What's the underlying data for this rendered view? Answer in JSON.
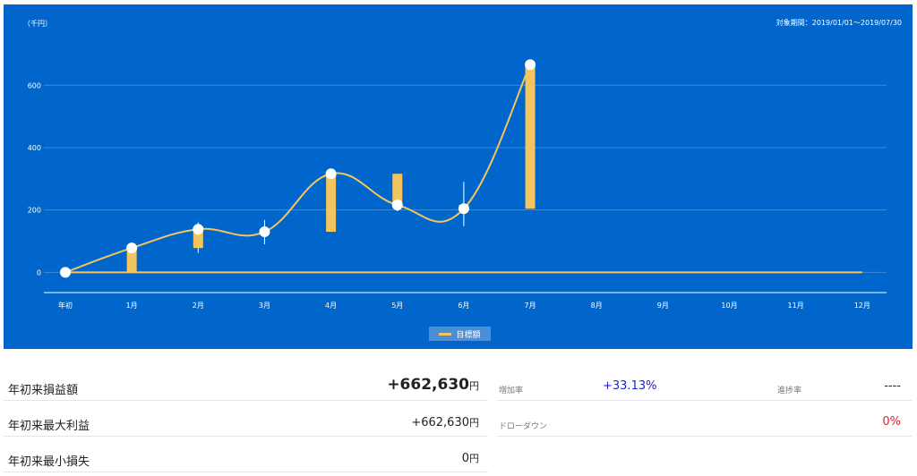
{
  "chart": {
    "unit_label": "（千円）",
    "period_label": "対象期間：2019/01/01〜2019/07/30",
    "legend_label": "目標額",
    "colors": {
      "background": "#0066cc",
      "line": "#f2c55e",
      "bar": "#f2c55e",
      "grid": "#3d8ad8",
      "marker": "#ffffff",
      "text": "#ffffff"
    }
  },
  "chart_data": {
    "type": "line",
    "categories": [
      "年初",
      "1月",
      "2月",
      "3月",
      "4月",
      "5月",
      "6月",
      "7月",
      "8月",
      "9月",
      "10月",
      "11月",
      "12月"
    ],
    "y_ticks": [
      0,
      200,
      400,
      600
    ],
    "ylim": [
      -65,
      730
    ],
    "series": [
      {
        "name": "目標額",
        "style": "flat line",
        "values": [
          0,
          0,
          0,
          0,
          0,
          0,
          0,
          0,
          0,
          0,
          0,
          0,
          0
        ]
      },
      {
        "style": "smoothed line with markers",
        "values": [
          0,
          78,
          138,
          130,
          316,
          216,
          204,
          666
        ]
      },
      {
        "style": "candlestick",
        "candles": [
          {
            "month": "1月",
            "open": 0,
            "close": 78,
            "high": 78,
            "low": 0
          },
          {
            "month": "2月",
            "open": 78,
            "close": 138,
            "high": 160,
            "low": 62
          },
          {
            "month": "3月",
            "open": 138,
            "close": 130,
            "high": 168,
            "low": 90
          },
          {
            "month": "4月",
            "open": 130,
            "close": 316,
            "high": 316,
            "low": 130
          },
          {
            "month": "5月",
            "open": 316,
            "close": 216,
            "high": 316,
            "low": 196
          },
          {
            "month": "6月",
            "open": 216,
            "close": 204,
            "high": 290,
            "low": 148
          },
          {
            "month": "7月",
            "open": 204,
            "close": 666,
            "high": 666,
            "low": 204
          }
        ]
      }
    ],
    "grid": true,
    "legend_position": "bottom-center"
  },
  "stats": {
    "ytd_pl_label": "年初来損益額",
    "ytd_pl_value": "+662,630",
    "ytd_max_profit_label": "年初来最大利益",
    "ytd_max_profit_value": "+662,630",
    "ytd_min_loss_label": "年初来最小損失",
    "ytd_min_loss_value": "0",
    "yen_unit": "円"
  },
  "kpis": {
    "increase_rate_label": "増加率",
    "increase_rate_value": "+33.13%",
    "progress_rate_label": "進捗率",
    "progress_rate_value": "----",
    "drawdown_label": "ドローダウン",
    "drawdown_value": "0%",
    "colors": {
      "increase": "#2222cc",
      "drawdown": "#e0202a",
      "neutral": "#222222"
    }
  }
}
